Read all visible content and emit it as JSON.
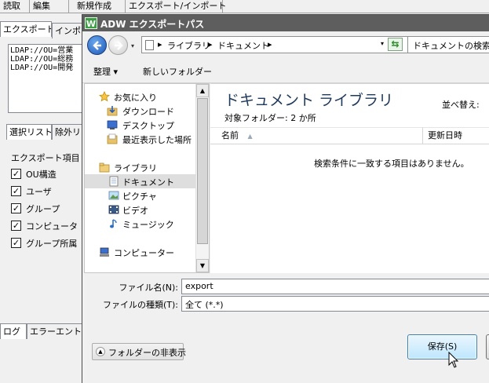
{
  "background_app": {
    "menus": [
      "読取",
      "編集",
      "新規作成",
      "エクスポート/インポート"
    ],
    "tabs": [
      "エクスポート",
      "インポ"
    ],
    "ldap_entries": [
      "LDAP://OU=営業",
      "LDAP://OU=総務",
      "LDAP://OU=開発"
    ],
    "subtabs": [
      "選択リスト",
      "除外リ"
    ],
    "export_items_heading": "エクスポート項目",
    "export_items": [
      {
        "label": "OU構造",
        "checked": true
      },
      {
        "label": "ユーザ",
        "checked": true
      },
      {
        "label": "グループ",
        "checked": true
      },
      {
        "label": "コンピュータ",
        "checked": true
      },
      {
        "label": "グループ所属",
        "checked": true
      }
    ],
    "bottom_tabs": [
      "ログ",
      "エラーエントリ"
    ],
    "check_mark": "✓"
  },
  "dialog": {
    "app_icon_letter": "W",
    "title": "ADW エクスポートパス",
    "address": {
      "crumbs": [
        "ライブラリ",
        "ドキュメント"
      ],
      "separator": "▸",
      "dropdown": "▾"
    },
    "search_placeholder": "ドキュメントの検索",
    "commands": {
      "organize": "整理 ▾",
      "new_folder": "新しいフォルダー"
    },
    "nav_pane": {
      "items": [
        {
          "label": "お気に入り",
          "icon": "star-icon"
        },
        {
          "label": "ダウンロード",
          "icon": "download-folder-icon"
        },
        {
          "label": "デスクトップ",
          "icon": "desktop-icon"
        },
        {
          "label": "最近表示した場所",
          "icon": "recent-places-icon"
        },
        {
          "label": "ライブラリ",
          "icon": "library-icon"
        },
        {
          "label": "ドキュメント",
          "icon": "document-icon",
          "selected": true
        },
        {
          "label": "ピクチャ",
          "icon": "picture-icon"
        },
        {
          "label": "ビデオ",
          "icon": "video-icon"
        },
        {
          "label": "ミュージック",
          "icon": "music-icon"
        },
        {
          "label": "コンピューター",
          "icon": "computer-icon"
        }
      ]
    },
    "content": {
      "library_title": "ドキュメント ライブラリ",
      "target_folders": "対象フォルダー: 2 か所",
      "arrange_by": "並べ替え:",
      "columns": [
        "名前",
        "更新日時"
      ],
      "empty_message": "検索条件に一致する項目はありません。"
    },
    "filename_label": "ファイル名(N):",
    "filename_value": "export",
    "filetype_label": "ファイルの種類(T):",
    "filetype_value": "全て (*.*)",
    "hide_folders_label": "フォルダーの非表示",
    "save_label": "保存(S)"
  }
}
